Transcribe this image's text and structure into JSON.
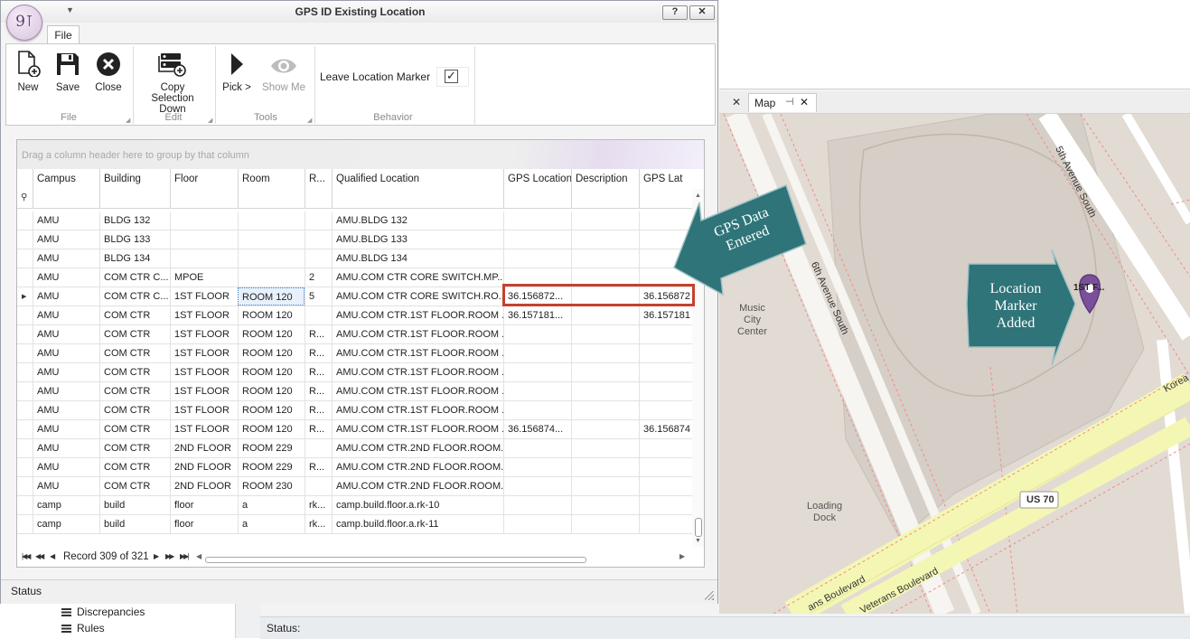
{
  "dialog": {
    "title": "GPS ID Existing Location",
    "logo_text": "9⊺",
    "help_label": "?",
    "close_label": "✕",
    "quick_access_icon": "dropdown-arrow-icon"
  },
  "ribbon": {
    "tab_label": "File",
    "buttons": {
      "new": "New",
      "save": "Save",
      "close": "Close",
      "copy_selection_down": "Copy Selection Down",
      "pick": "Pick >",
      "show_me": "Show Me"
    },
    "groups": {
      "file": "File",
      "edit": "Edit",
      "tools": "Tools",
      "behavior": "Behavior"
    },
    "leave_location_marker": {
      "label": "Leave Location Marker",
      "checked": true,
      "check_glyph": "✓"
    }
  },
  "grid": {
    "group_hint": "Drag a column header here to group by that column",
    "columns": [
      "Campus",
      "Building",
      "Floor",
      "Room",
      "R...",
      "Qualified Location",
      "GPS Location",
      "Description",
      "GPS Lat"
    ],
    "rows": [
      [
        "AMU",
        "BLDG 132",
        "",
        "",
        "",
        "AMU.BLDG 132",
        "",
        "",
        ""
      ],
      [
        "AMU",
        "BLDG 133",
        "",
        "",
        "",
        "AMU.BLDG 133",
        "",
        "",
        ""
      ],
      [
        "AMU",
        "BLDG 134",
        "",
        "",
        "",
        "AMU.BLDG 134",
        "",
        "",
        ""
      ],
      [
        "AMU",
        "COM CTR C...",
        "MPOE",
        "",
        "2",
        "AMU.COM CTR CORE SWITCH.MP...",
        "",
        "",
        ""
      ],
      [
        "AMU",
        "COM CTR C...",
        "1ST FLOOR",
        "ROOM 120",
        "5",
        "AMU.COM CTR CORE SWITCH.RO...",
        "36.156872...",
        "",
        "36.156872"
      ],
      [
        "AMU",
        "COM CTR",
        "1ST FLOOR",
        "ROOM 120",
        "",
        "AMU.COM CTR.1ST FLOOR.ROOM ...",
        "36.157181...",
        "",
        "36.157181"
      ],
      [
        "AMU",
        "COM CTR",
        "1ST FLOOR",
        "ROOM 120",
        "R...",
        "AMU.COM CTR.1ST FLOOR.ROOM ...",
        "",
        "",
        ""
      ],
      [
        "AMU",
        "COM CTR",
        "1ST FLOOR",
        "ROOM 120",
        "R...",
        "AMU.COM CTR.1ST FLOOR.ROOM ...",
        "",
        "",
        ""
      ],
      [
        "AMU",
        "COM CTR",
        "1ST FLOOR",
        "ROOM 120",
        "R...",
        "AMU.COM CTR.1ST FLOOR.ROOM ...",
        "",
        "",
        ""
      ],
      [
        "AMU",
        "COM CTR",
        "1ST FLOOR",
        "ROOM 120",
        "R...",
        "AMU.COM CTR.1ST FLOOR.ROOM ...",
        "",
        "",
        ""
      ],
      [
        "AMU",
        "COM CTR",
        "1ST FLOOR",
        "ROOM 120",
        "R...",
        "AMU.COM CTR.1ST FLOOR.ROOM ...",
        "",
        "",
        ""
      ],
      [
        "AMU",
        "COM CTR",
        "1ST FLOOR",
        "ROOM 120",
        "R...",
        "AMU.COM CTR.1ST FLOOR.ROOM ...",
        "36.156874...",
        "",
        "36.156874"
      ],
      [
        "AMU",
        "COM CTR",
        "2ND FLOOR",
        "ROOM 229",
        "",
        "AMU.COM CTR.2ND FLOOR.ROOM...",
        "",
        "",
        ""
      ],
      [
        "AMU",
        "COM CTR",
        "2ND FLOOR",
        "ROOM 229",
        "R...",
        "AMU.COM CTR.2ND FLOOR.ROOM...",
        "",
        "",
        ""
      ],
      [
        "AMU",
        "COM CTR",
        "2ND FLOOR",
        "ROOM 230",
        "",
        "AMU.COM CTR.2ND FLOOR.ROOM...",
        "",
        "",
        ""
      ],
      [
        "camp",
        "build",
        "floor",
        "a",
        "rk...",
        "camp.build.floor.a.rk-10",
        "",
        "",
        ""
      ],
      [
        "camp",
        "build",
        "floor",
        "a",
        "rk...",
        "camp.build.floor.a.rk-11",
        "",
        "",
        ""
      ]
    ],
    "current_row_index": 4,
    "focused_column_index": 3,
    "record_text": "Record 309 of 321"
  },
  "dialog_status": "Status",
  "background": {
    "map_tab_label": "Map",
    "status_label": "Status:",
    "tree_items": [
      "Discrepancies",
      "Rules"
    ],
    "map_labels": {
      "fifth_avenue": "5th Avenue South",
      "sixth_avenue": "6th Avenue South",
      "music_city_center": "Music\nCity\nCenter",
      "loading_dock": "Loading\nDock",
      "us70": "US 70",
      "korean": "Korea",
      "veterans1": "ans Boulevard",
      "veterans2": "Veterans Boulevard",
      "marker_label": "1ST F..."
    }
  },
  "annotations": {
    "gps_data_entered": [
      "GPS Data",
      "Entered"
    ],
    "location_marker_added": [
      "Location",
      "Marker",
      "Added"
    ]
  },
  "colors": {
    "callout_fill": "#2e7479",
    "highlight_border": "#c2432e",
    "marker_fill": "#7a4f9b",
    "road_yellow": "#f4f7b4"
  }
}
